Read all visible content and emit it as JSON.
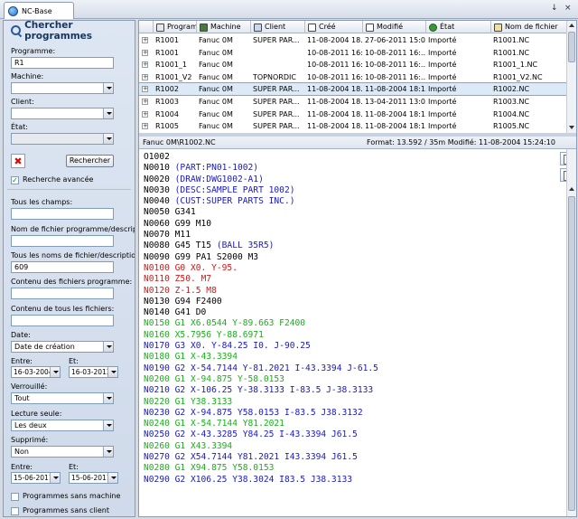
{
  "app": {
    "tab_title": "NC-Base",
    "pin_glyph": "↓",
    "close_glyph": "×"
  },
  "search_panel": {
    "title": "Chercher programmes",
    "programme_label": "Programme:",
    "programme_value": "R1",
    "machine_label": "Machine:",
    "machine_value": "",
    "client_label": "Client:",
    "client_value": "",
    "etat_label": "État:",
    "etat_value": "",
    "clear_glyph": "✖",
    "search_button": "Rechercher",
    "advanced_label": "Recherche avancée",
    "advanced_checked": true,
    "all_fields_label": "Tous les champs:",
    "all_fields_value": "",
    "program_filename_label": "Nom de fichier programme/description",
    "program_filename_value": "",
    "all_filenames_label": "Tous les noms de fichier/description",
    "all_filenames_value": "609",
    "program_content_label": "Contenu des fichiers programme:",
    "program_content_value": "",
    "all_content_label": "Contenu de tous les fichiers:",
    "all_content_value": "",
    "date_label": "Date:",
    "date_value": "Date de création",
    "entre1_label": "Entre:",
    "et1_label": "Et:",
    "entre1_value": "16-03-2004",
    "et1_value": "16-03-2012",
    "verrouille_label": "Verrouillé:",
    "verrouille_value": "Tout",
    "lecture_label": "Lecture seule:",
    "lecture_value": "Les deux",
    "supprime_label": "Supprimé:",
    "supprime_value": "Non",
    "entre2_label": "Entre:",
    "et2_label": "Et:",
    "entre2_value": "15-06-2011",
    "et2_value": "15-06-2011",
    "sans_machine_label": "Programmes sans machine",
    "sans_client_label": "Programmes sans client"
  },
  "grid": {
    "columns": [
      "Programme",
      "Machine",
      "Client",
      "Créé",
      "Modifié",
      "État",
      "Nom de fichier"
    ],
    "column_icons": [
      "program-icon",
      "machine-icon",
      "client-icon",
      "created-icon",
      "modified-icon",
      "state-icon",
      "file-icon"
    ],
    "rows": [
      [
        "R1001",
        "Fanuc 0M",
        "SUPER PAR...",
        "11-08-2004 18...",
        "27-06-2011 15:0...",
        "Importé",
        "R1001.NC"
      ],
      [
        "R1001",
        "Fanuc 0M",
        "",
        "10-08-2011 16:...",
        "10-08-2011 16:...",
        "Importé",
        "R1001.NC"
      ],
      [
        "R1001_1",
        "Fanuc 0M",
        "",
        "10-08-2011 16:...",
        "10-08-2011 16:...",
        "Importé",
        "R1001_1.NC"
      ],
      [
        "R1001_V2",
        "Fanuc 0M",
        "TOPNORDIC",
        "10-08-2011 16:...",
        "10-08-2011 16:...",
        "Importé",
        "R1001_V2.NC"
      ],
      [
        "R1002",
        "Fanuc 0M",
        "SUPER PAR...",
        "11-08-2004 18...",
        "11-08-2004 18:1...",
        "Importé",
        "R1002.NC"
      ],
      [
        "R1003",
        "Fanuc 0M",
        "SUPER PAR...",
        "11-08-2004 18...",
        "13-04-2011 13:0...",
        "Importé",
        "R1003.NC"
      ],
      [
        "R1004",
        "Fanuc 0M",
        "SUPER PAR...",
        "11-08-2004 18...",
        "11-08-2004 18:1...",
        "Importé",
        "R1004.NC"
      ],
      [
        "R1005",
        "Fanuc 0M",
        "SUPER PAR...",
        "11-08-2004 18...",
        "11-08-2004 18:1...",
        "Importé",
        "R1005.NC"
      ]
    ],
    "selected_index": 4
  },
  "file_view": {
    "path": "Fanuc 0M\\R1002.NC",
    "meta": "Format: 13.592 / 35m   Modifié: 11-08-2004 15:24:10",
    "lines": [
      {
        "t": "O1002",
        "c": "black"
      },
      {
        "t": "N0010 (PART:PN01-1002)",
        "c": "mixed",
        "a": "N0010 ",
        "b": "(PART:PN01-1002)"
      },
      {
        "t": "N0020 (DRAW:DWG1002-A1)",
        "c": "mixed",
        "a": "N0020 ",
        "b": "(DRAW:DWG1002-A1)"
      },
      {
        "t": "N0030 (DESC:SAMPLE PART 1002)",
        "c": "mixed",
        "a": "N0030 ",
        "b": "(DESC:SAMPLE PART 1002)"
      },
      {
        "t": "N0040 (CUST:SUPER PARTS INC.)",
        "c": "mixed",
        "a": "N0040 ",
        "b": "(CUST:SUPER PARTS INC.)"
      },
      {
        "t": "N0050 G341",
        "c": "black"
      },
      {
        "t": "N0060 G99 M10",
        "c": "black"
      },
      {
        "t": "N0070 M11",
        "c": "black"
      },
      {
        "t": "N0080 G45 T15 (BALL 35R5)",
        "c": "mixed",
        "a": "N0080 G45 T15 ",
        "b": "(BALL 35R5)"
      },
      {
        "t": "N0090 G99 PA1 S2000 M3",
        "c": "black"
      },
      {
        "t": "N0100 G0 X0. Y-95.",
        "c": "red"
      },
      {
        "t": "N0110 Z50. M7",
        "c": "red"
      },
      {
        "t": "N0120 Z-1.5 M8",
        "c": "red"
      },
      {
        "t": "N0130 G94 F2400",
        "c": "black"
      },
      {
        "t": "N0140 G41 D0",
        "c": "black"
      },
      {
        "t": "N0150 G1 X6.0544 Y-89.663 F2400",
        "c": "green"
      },
      {
        "t": "N0160 X5.7956 Y-88.6971",
        "c": "green"
      },
      {
        "t": "N0170 G3 X0. Y-84.25 I0. J-90.25",
        "c": "blue"
      },
      {
        "t": "N0180 G1 X-43.3394",
        "c": "green"
      },
      {
        "t": "N0190 G2 X-54.7144 Y-81.2021 I-43.3394 J-61.5",
        "c": "blue"
      },
      {
        "t": "N0200 G1 X-94.875 Y-58.0153",
        "c": "green"
      },
      {
        "t": "N0210 G2 X-106.25 Y-38.3133 I-83.5 J-38.3133",
        "c": "blue"
      },
      {
        "t": "N0220 G1 Y38.3133",
        "c": "green"
      },
      {
        "t": "N0230 G2 X-94.875 Y58.0153 I-83.5 J38.3132",
        "c": "blue"
      },
      {
        "t": "N0240 G1 X-54.7144 Y81.2021",
        "c": "green"
      },
      {
        "t": "N0250 G2 X-43.3285 Y84.25 I-43.3394 J61.5",
        "c": "blue"
      },
      {
        "t": "N0260 G1 X43.3394",
        "c": "green"
      },
      {
        "t": "N0270 G2 X54.7144 Y81.2021 I43.3394 J61.5",
        "c": "blue"
      },
      {
        "t": "N0280 G1 X94.875 Y58.0153",
        "c": "green"
      },
      {
        "t": "N0290 G2 X106.25 Y38.3024 I83.5 J38.3133",
        "c": "blue"
      }
    ]
  },
  "colors": {
    "code_black": "#000000",
    "code_blue": "#1818c8",
    "code_red": "#d01818",
    "code_green": "#18b018",
    "selected_row": "#dceaf8"
  }
}
